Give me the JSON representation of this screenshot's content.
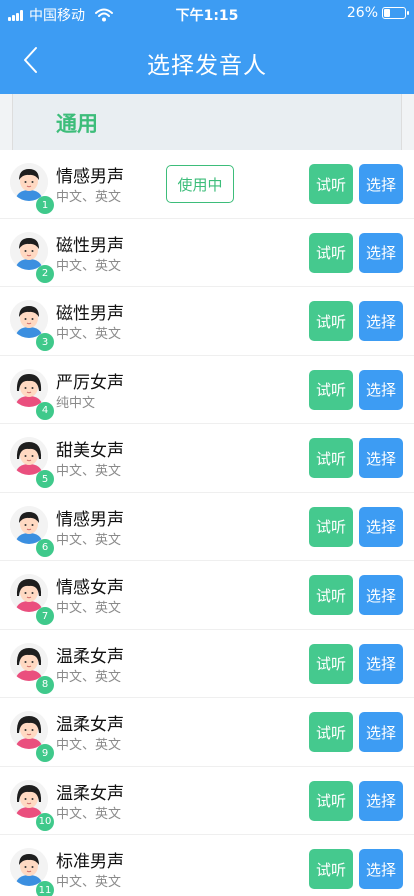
{
  "status": {
    "carrier": "中国移动",
    "time": "下午1:15",
    "battery": "26%",
    "battery_level": 0.26
  },
  "nav": {
    "title": "选择发音人",
    "back_icon": "chevron-left-icon"
  },
  "section": {
    "label": "通用"
  },
  "actions": {
    "listen": "试听",
    "select": "选择",
    "in_use": "使用中"
  },
  "colors": {
    "header": "#3d9cf3",
    "accent_green": "#3dbd7a",
    "listen_button": "#45c98e",
    "select_button": "#3d9cf3"
  },
  "voices": [
    {
      "index": "1",
      "name": "情感男声",
      "lang": "中文、英文",
      "gender": "male",
      "in_use": true
    },
    {
      "index": "2",
      "name": "磁性男声",
      "lang": "中文、英文",
      "gender": "male",
      "in_use": false
    },
    {
      "index": "3",
      "name": "磁性男声",
      "lang": "中文、英文",
      "gender": "male",
      "in_use": false
    },
    {
      "index": "4",
      "name": "严厉女声",
      "lang": "纯中文",
      "gender": "female",
      "in_use": false
    },
    {
      "index": "5",
      "name": "甜美女声",
      "lang": "中文、英文",
      "gender": "female",
      "in_use": false
    },
    {
      "index": "6",
      "name": "情感男声",
      "lang": "中文、英文",
      "gender": "male",
      "in_use": false
    },
    {
      "index": "7",
      "name": "情感女声",
      "lang": "中文、英文",
      "gender": "female",
      "in_use": false
    },
    {
      "index": "8",
      "name": "温柔女声",
      "lang": "中文、英文",
      "gender": "female",
      "in_use": false
    },
    {
      "index": "9",
      "name": "温柔女声",
      "lang": "中文、英文",
      "gender": "female",
      "in_use": false
    },
    {
      "index": "10",
      "name": "温柔女声",
      "lang": "中文、英文",
      "gender": "female",
      "in_use": false
    },
    {
      "index": "11",
      "name": "标准男声",
      "lang": "中文、英文",
      "gender": "male",
      "in_use": false
    }
  ]
}
